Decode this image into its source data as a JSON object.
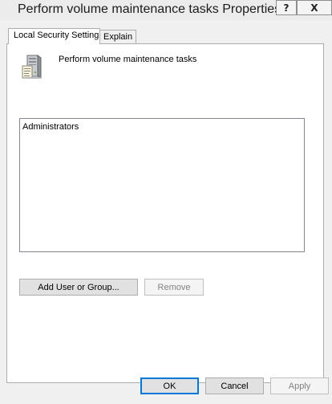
{
  "window": {
    "title": "Perform volume maintenance tasks Properties",
    "help_glyph": "?",
    "close_glyph": "X"
  },
  "tabs": [
    {
      "label": "Local Security Setting",
      "active": true
    },
    {
      "label": "Explain",
      "active": false
    }
  ],
  "policy": {
    "icon": "server-policy-icon",
    "name": "Perform volume maintenance tasks"
  },
  "accounts": {
    "items": [
      "Administrators"
    ]
  },
  "panel_buttons": {
    "add_label": "Add User or Group...",
    "remove_label": "Remove"
  },
  "dialog_buttons": {
    "ok_label": "OK",
    "cancel_label": "Cancel",
    "apply_label": "Apply"
  },
  "colors": {
    "window_bg": "#f0f0f0",
    "panel_bg": "#ffffff",
    "default_button_border": "#0078d7",
    "disabled_text": "#838383"
  }
}
